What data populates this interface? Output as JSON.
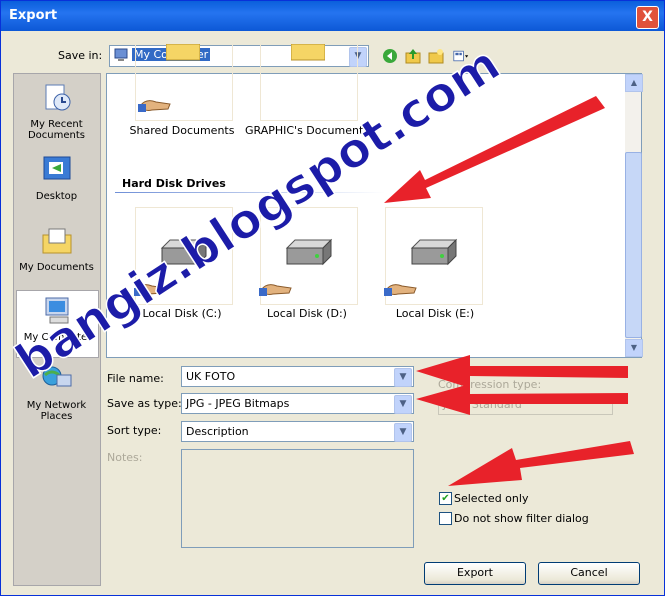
{
  "window": {
    "title": "Export",
    "close_glyph": "X"
  },
  "save_in": {
    "label": "Save in:",
    "value": "My Computer"
  },
  "places": [
    {
      "label": "My Recent Documents",
      "icon": "recent-documents-icon"
    },
    {
      "label": "Desktop",
      "icon": "desktop-icon"
    },
    {
      "label": "My Documents",
      "icon": "my-documents-icon"
    },
    {
      "label": "My Computer",
      "icon": "my-computer-icon",
      "selected": true
    },
    {
      "label": "My Network Places",
      "icon": "network-places-icon"
    }
  ],
  "files": {
    "top_items": [
      "Shared Documents",
      "GRAPHIC's Documents"
    ],
    "group_header": "Hard Disk Drives",
    "drives": [
      "Local Disk (C:)",
      "Local Disk (D:)",
      "Local Disk (E:)"
    ]
  },
  "form": {
    "file_name_label": "File name:",
    "file_name_value": "UK FOTO",
    "save_as_type_label": "Save as type:",
    "save_as_type_value": "JPG - JPEG Bitmaps",
    "sort_type_label": "Sort type:",
    "sort_type_value": "Description",
    "notes_label": "Notes:",
    "compression_label": "Compression type:",
    "compression_value": "JPEG Standard"
  },
  "options": [
    {
      "label": "Selected only",
      "checked": true
    },
    {
      "label": "Do not show filter dialog",
      "checked": false
    }
  ],
  "buttons": {
    "export": "Export",
    "cancel": "Cancel"
  },
  "watermark": "bangiz.blogspot.com",
  "colors": {
    "titlebar": "#0a5fdb",
    "arrow": "#e8222a",
    "watermark": "#1c1ca8"
  }
}
